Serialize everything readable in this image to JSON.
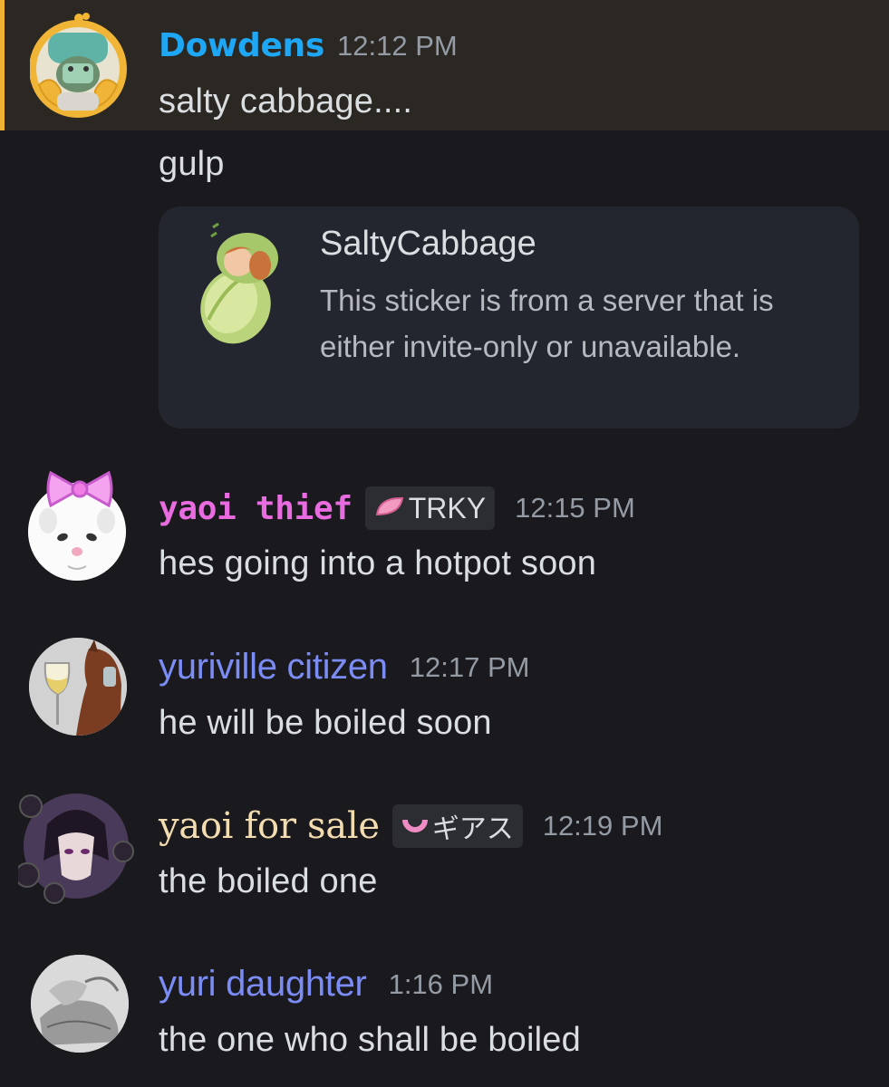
{
  "messages": [
    {
      "username": "Dowdens",
      "username_color": "#1ea7f5",
      "time": "12:12 PM",
      "lines": [
        "salty cabbage....",
        "gulp"
      ],
      "highlighted": true,
      "sticker": {
        "name": "SaltyCabbage",
        "description": "This sticker is from a server that is either invite-only or unavailable."
      }
    },
    {
      "username": "yaoi thief",
      "username_color": "#e86ce0",
      "tag": "TRKY",
      "tag_icon": "pink-leaf-icon",
      "time": "12:15 PM",
      "lines": [
        "hes going into a hotpot soon"
      ]
    },
    {
      "username": "yuriville citizen",
      "username_color": "#7b8cf5",
      "time": "12:17 PM",
      "lines": [
        "he will be boiled soon"
      ]
    },
    {
      "username": "yaoi for sale",
      "username_color": "#f3dcb0",
      "tag": "ギアス",
      "tag_icon": "pink-ring-icon",
      "time": "12:19 PM",
      "lines": [
        "the boiled one"
      ]
    },
    {
      "username": "yuri daughter",
      "username_color": "#7b8cf5",
      "time": "1:16 PM",
      "lines": [
        "the one who shall be boiled"
      ]
    }
  ]
}
